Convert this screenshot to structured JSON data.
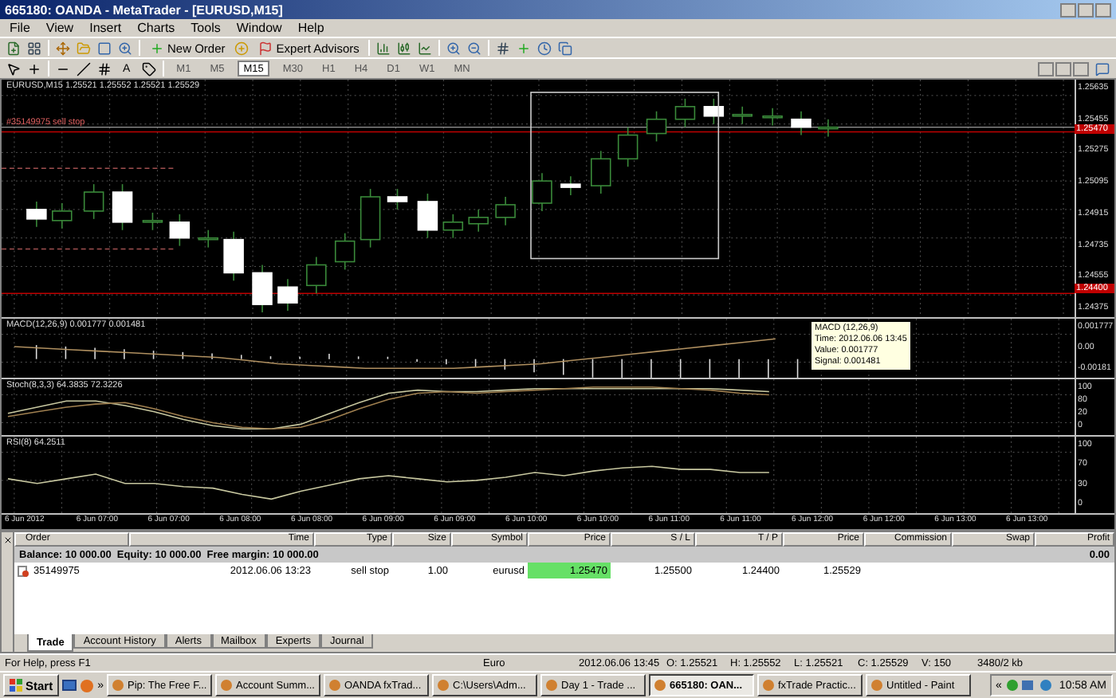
{
  "window": {
    "title": "665180: OANDA - MetaTrader - [EURUSD,M15]"
  },
  "menu": [
    "File",
    "View",
    "Insert",
    "Charts",
    "Tools",
    "Window",
    "Help"
  ],
  "toolbar": {
    "new_order": "New Order",
    "expert_advisors": "Expert Advisors"
  },
  "drawing_tools": {
    "text_tool": "A"
  },
  "timeframes": [
    {
      "label": "M1",
      "selected": false
    },
    {
      "label": "M5",
      "selected": false
    },
    {
      "label": "M15",
      "selected": true
    },
    {
      "label": "M30",
      "selected": false
    },
    {
      "label": "H1",
      "selected": false
    },
    {
      "label": "H4",
      "selected": false
    },
    {
      "label": "D1",
      "selected": false
    },
    {
      "label": "W1",
      "selected": false
    },
    {
      "label": "MN",
      "selected": false
    }
  ],
  "chart": {
    "header": "EURUSD,M15  1.25521 1.25552 1.25521 1.25529",
    "order_label": "#35149975 sell stop",
    "price_axis": [
      "1.25635",
      "1.25455",
      "1.25275",
      "1.25095",
      "1.24915",
      "1.24735",
      "1.24555",
      "1.24375"
    ],
    "price_tags": [
      "1.25470",
      "1.24400"
    ],
    "time_axis": [
      "6 Jun 2012",
      "6 Jun 07:00",
      "6 Jun 07:00",
      "6 Jun 08:00",
      "6 Jun 08:00",
      "6 Jun 09:00",
      "6 Jun 09:00",
      "6 Jun 10:00",
      "6 Jun 10:00",
      "6 Jun 11:00",
      "6 Jun 11:00",
      "6 Jun 12:00",
      "6 Jun 12:00",
      "6 Jun 13:00",
      "6 Jun 13:00"
    ]
  },
  "indicators": [
    {
      "kind": "macd",
      "label": "MACD(12,26,9) 0.001777 0.001481",
      "axis": [
        "0.001777",
        "0.00",
        "-0.00181"
      ]
    },
    {
      "kind": "stoch",
      "label": "Stoch(8,3,3) 64.3835 72.3226",
      "axis": [
        "100",
        "80",
        "20",
        "0"
      ]
    },
    {
      "kind": "rsi",
      "label": "RSI(8) 64.2511",
      "axis": [
        "100",
        "70",
        "30",
        "0"
      ]
    }
  ],
  "tooltip": [
    "MACD (12,26,9)",
    "Time: 2012.06.06 13:45",
    "Value: 0.001777",
    "Signal: 0.001481"
  ],
  "terminal": {
    "columns": [
      "Order",
      "Time",
      "Type",
      "Size",
      "Symbol",
      "Price",
      "S / L",
      "T / P",
      "Price",
      "Commission",
      "Swap",
      "Profit"
    ],
    "summary": {
      "text": "Balance: 10 000.00  Equity: 10 000.00  Free margin: 10 000.00",
      "profit": "0.00"
    },
    "orders": [
      {
        "cells": [
          {
            "text": "35149975",
            "highlighted": false
          },
          {
            "text": "2012.06.06 13:23",
            "highlighted": false
          },
          {
            "text": "sell stop",
            "highlighted": false
          },
          {
            "text": "1.00",
            "highlighted": false
          },
          {
            "text": "eurusd",
            "highlighted": false
          },
          {
            "text": "1.25470",
            "highlighted": true
          },
          {
            "text": "1.25500",
            "highlighted": false
          },
          {
            "text": "1.24400",
            "highlighted": false
          },
          {
            "text": "1.25529",
            "highlighted": false
          }
        ]
      }
    ],
    "tabs": [
      {
        "label": "Trade",
        "selected": true
      },
      {
        "label": "Account History",
        "selected": false
      },
      {
        "label": "Alerts",
        "selected": false
      },
      {
        "label": "Mailbox",
        "selected": false
      },
      {
        "label": "Experts",
        "selected": false
      },
      {
        "label": "Journal",
        "selected": false
      }
    ]
  },
  "status_bar": [
    "For Help, press F1",
    "Euro",
    "2012.06.06 13:45",
    "O: 1.25521",
    "H: 1.25552",
    "L: 1.25521",
    "C: 1.25529",
    "V: 150",
    "3480/2 kb"
  ],
  "taskbar": {
    "start": "Start",
    "overflow": "»",
    "tasks": [
      {
        "label": "Pip: The Free F...",
        "selected": false
      },
      {
        "label": "Account Summ...",
        "selected": false
      },
      {
        "label": "OANDA fxTrad...",
        "selected": false
      },
      {
        "label": "C:\\Users\\Adm...",
        "selected": false
      },
      {
        "label": "Day 1 - Trade ...",
        "selected": false
      },
      {
        "label": "665180: OAN...",
        "selected": true
      },
      {
        "label": "fxTrade Practic...",
        "selected": false
      },
      {
        "label": "Untitled - Paint",
        "selected": false
      }
    ],
    "tray_toggle": "«",
    "clock": "10:58 AM"
  }
}
